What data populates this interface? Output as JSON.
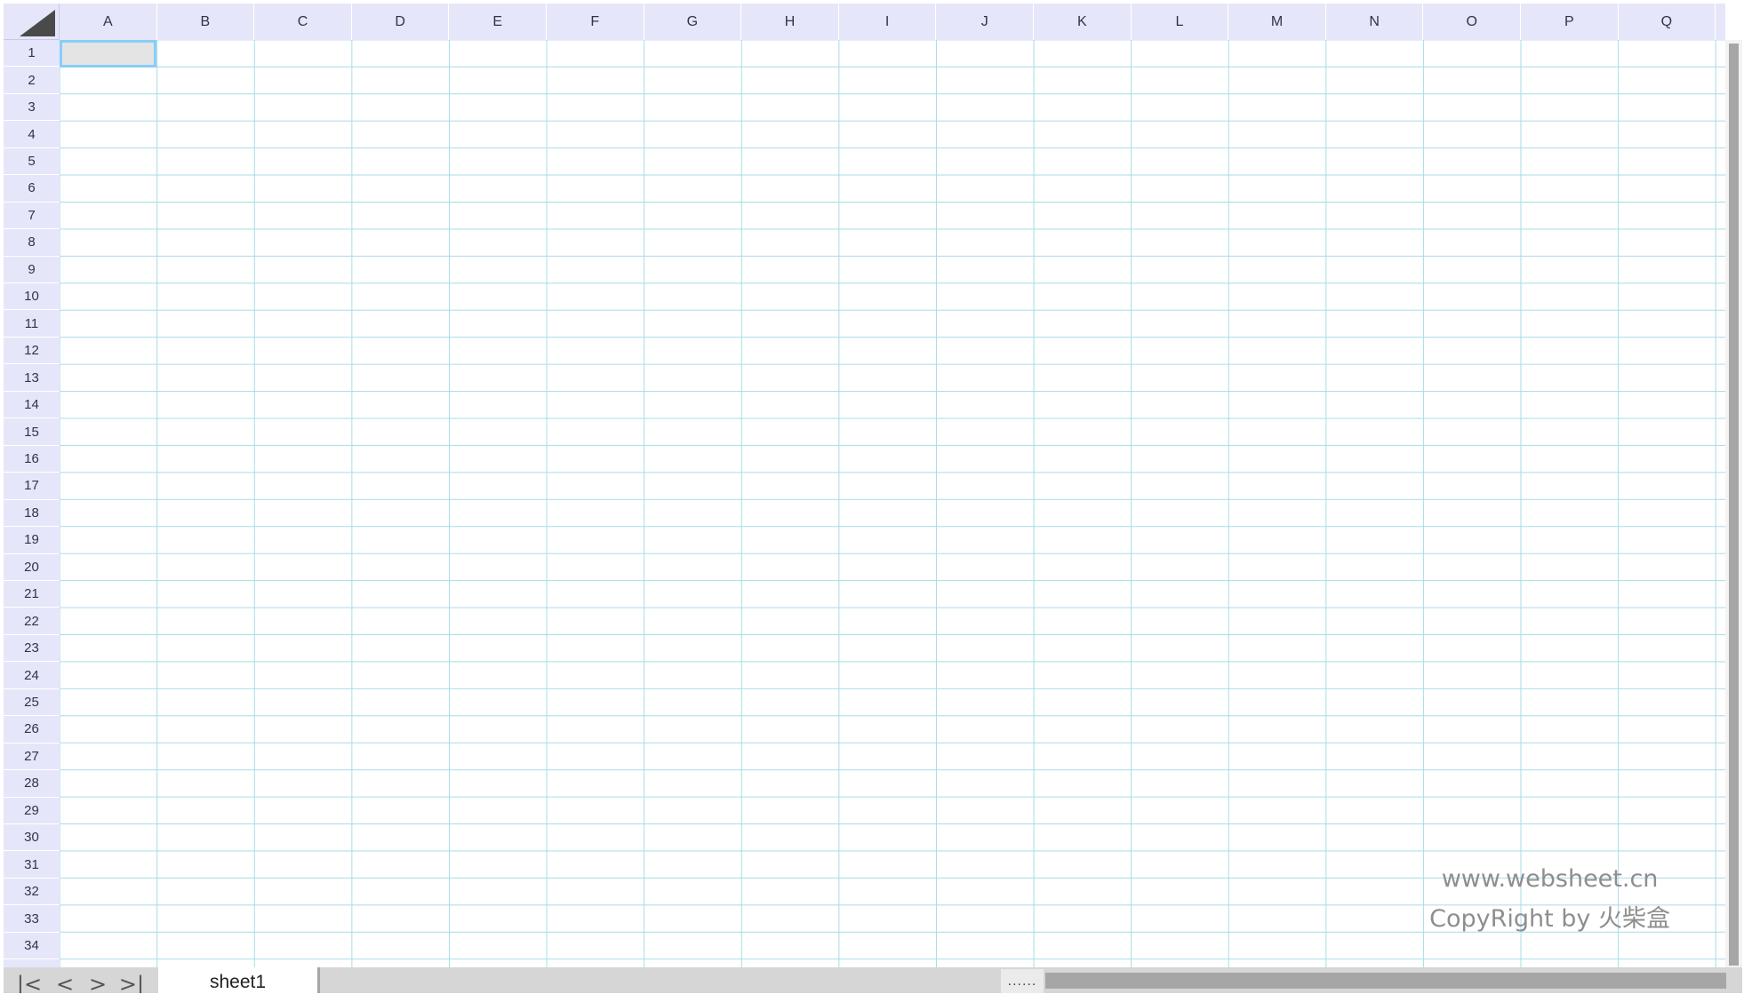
{
  "columns": [
    "A",
    "B",
    "C",
    "D",
    "E",
    "F",
    "G",
    "H",
    "I",
    "J",
    "K",
    "L",
    "M",
    "N",
    "O",
    "P",
    "Q"
  ],
  "rows": [
    "1",
    "2",
    "3",
    "4",
    "5",
    "6",
    "7",
    "8",
    "9",
    "10",
    "11",
    "12",
    "13",
    "14",
    "15",
    "16",
    "17",
    "18",
    "19",
    "20",
    "21",
    "22",
    "23",
    "24",
    "25",
    "26",
    "27",
    "28",
    "29",
    "30",
    "31",
    "32",
    "33",
    "34"
  ],
  "selected_cell": "A1",
  "watermark": {
    "line1": "www.websheet.cn",
    "line2": "CopyRight by 火柴盒"
  },
  "tabbar": {
    "first_icon": "first-sheet-icon",
    "prev_icon": "previous-sheet-icon",
    "next_icon": "next-sheet-icon",
    "last_icon": "last-sheet-icon",
    "sheet_tab": "sheet1",
    "split_handle": "......"
  },
  "colors": {
    "header_bg": "#e6e6fa",
    "grid_line": "#a9dce6",
    "selection_border": "#87cefa",
    "scrollbar_thumb": "#a6a6a6"
  }
}
